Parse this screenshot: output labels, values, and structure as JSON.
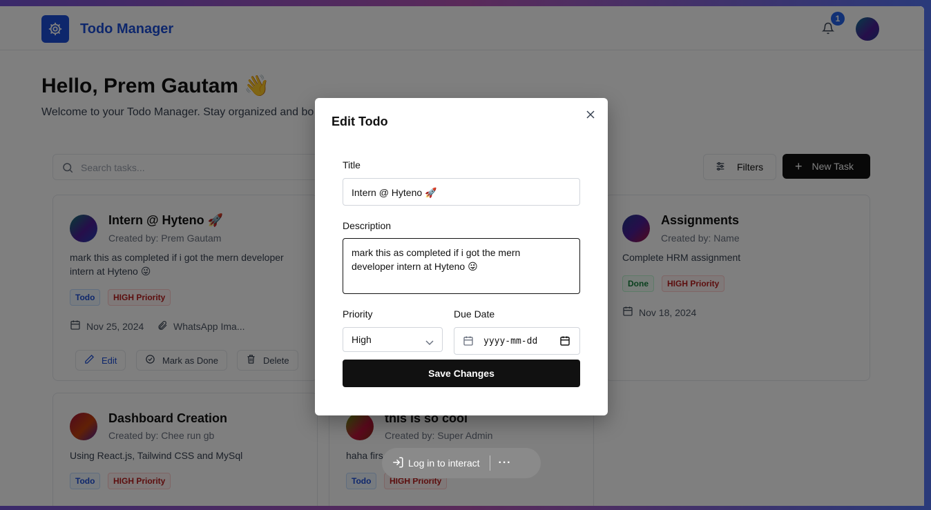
{
  "header": {
    "app_title": "Todo Manager",
    "notification_count": "1"
  },
  "hero": {
    "greeting": "Hello, Prem Gautam 👋",
    "welcome": "Welcome to your Todo Manager. Stay organized and bo"
  },
  "toolbar": {
    "search_placeholder": "Search tasks...",
    "filters_label": "Filters",
    "new_task_label": "New Task"
  },
  "cards": [
    {
      "title": "Intern @ Hyteno 🚀",
      "created_by": "Created by: Prem Gautam",
      "description_line1": "mark this as completed if i got the mern developer",
      "description_line2": "intern at Hyteno 😜",
      "status": "Todo",
      "priority": "HIGH Priority",
      "date": "Nov 25, 2024",
      "attachment": "WhatsApp Ima...",
      "edit_label": "Edit",
      "done_label": "Mark as Done",
      "delete_label": "Delete"
    },
    {
      "title": "Assignments",
      "created_by": "Created by: Name",
      "description": "Complete HRM assignment",
      "status": "Done",
      "priority": "HIGH Priority",
      "date": "Nov 18, 2024"
    },
    {
      "title": "Dashboard Creation",
      "created_by": "Created by: Chee run gb",
      "description": "Using React.js, Tailwind CSS and MySql",
      "status": "Todo",
      "priority": "HIGH Priority"
    },
    {
      "title": "this is so cool",
      "created_by": "Created by: Super Admin",
      "description": "haha firs",
      "status": "Todo",
      "priority": "HIGH Priority"
    }
  ],
  "modal": {
    "title": "Edit Todo",
    "title_label": "Title",
    "title_value": "Intern @ Hyteno 🚀",
    "description_label": "Description",
    "description_value_line1": "mark this as completed if i got the mern",
    "description_value_line2": "developer intern at Hyteno 😜",
    "priority_label": "Priority",
    "priority_value": "High",
    "due_date_label": "Due Date",
    "due_date_placeholder": "yyyy-mm-dd",
    "save_label": "Save Changes"
  },
  "login_pill": {
    "label": "Log in to interact"
  }
}
